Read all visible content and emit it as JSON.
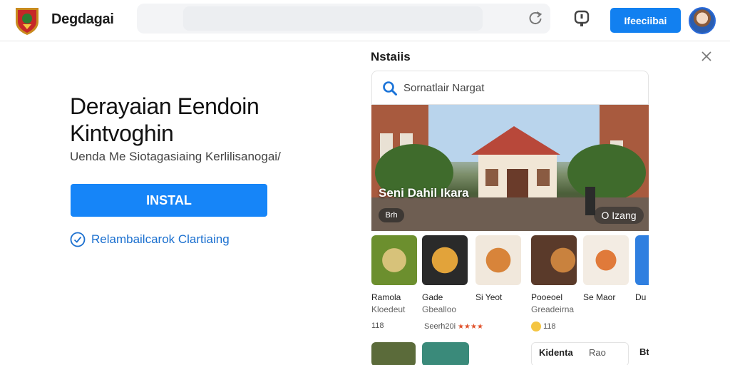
{
  "header": {
    "brand": "Degdagai",
    "primary_button": "Ifeeciibai"
  },
  "hero": {
    "title": "Derayaian Eendoin Kintvoghin",
    "subtitle": "Uenda Me Siotagasiaing Kerlilisanogai/",
    "install_label": "INSTAL",
    "check_label": "Relambailcarok Clartiaing"
  },
  "panel": {
    "title": "Nstaiis",
    "search_text": "Sornatlair Nargat",
    "feature": {
      "label": "Seni Dahil Ikara",
      "pill_left": "Brh",
      "pill_right": "O Izang"
    },
    "cards": [
      {
        "name": "Ramola",
        "sub": "Kloedeut",
        "meta": "118",
        "thumb": "#7a9a3a"
      },
      {
        "name": "Gade",
        "sub": "Gbealloo",
        "meta": "Seerh20i",
        "thumb": "#c98a2a"
      },
      {
        "name": "Si Yeot",
        "sub": "",
        "meta": "",
        "thumb": "#c97a38"
      },
      {
        "name": "Pooeoel",
        "sub": "Greadeirna",
        "meta": "118",
        "thumb": "#8a5a3a"
      },
      {
        "name": "Se Maor",
        "sub": "",
        "meta": "",
        "thumb": "#b86a3a"
      },
      {
        "name": "Du",
        "sub": "",
        "meta": "",
        "thumb": "#d9a048"
      }
    ],
    "row2": [
      {
        "label": "",
        "color": "#5b6b3a"
      },
      {
        "label": "",
        "color": "#3a8a7a"
      },
      {
        "label": "Kidenta",
        "tag": "Rao",
        "color": "#ffffff"
      },
      {
        "label": "Bt",
        "color": "#ffffff"
      }
    ]
  },
  "colors": {
    "accent": "#1685f8",
    "link": "#1a6fcf",
    "star": "#e0522c"
  }
}
